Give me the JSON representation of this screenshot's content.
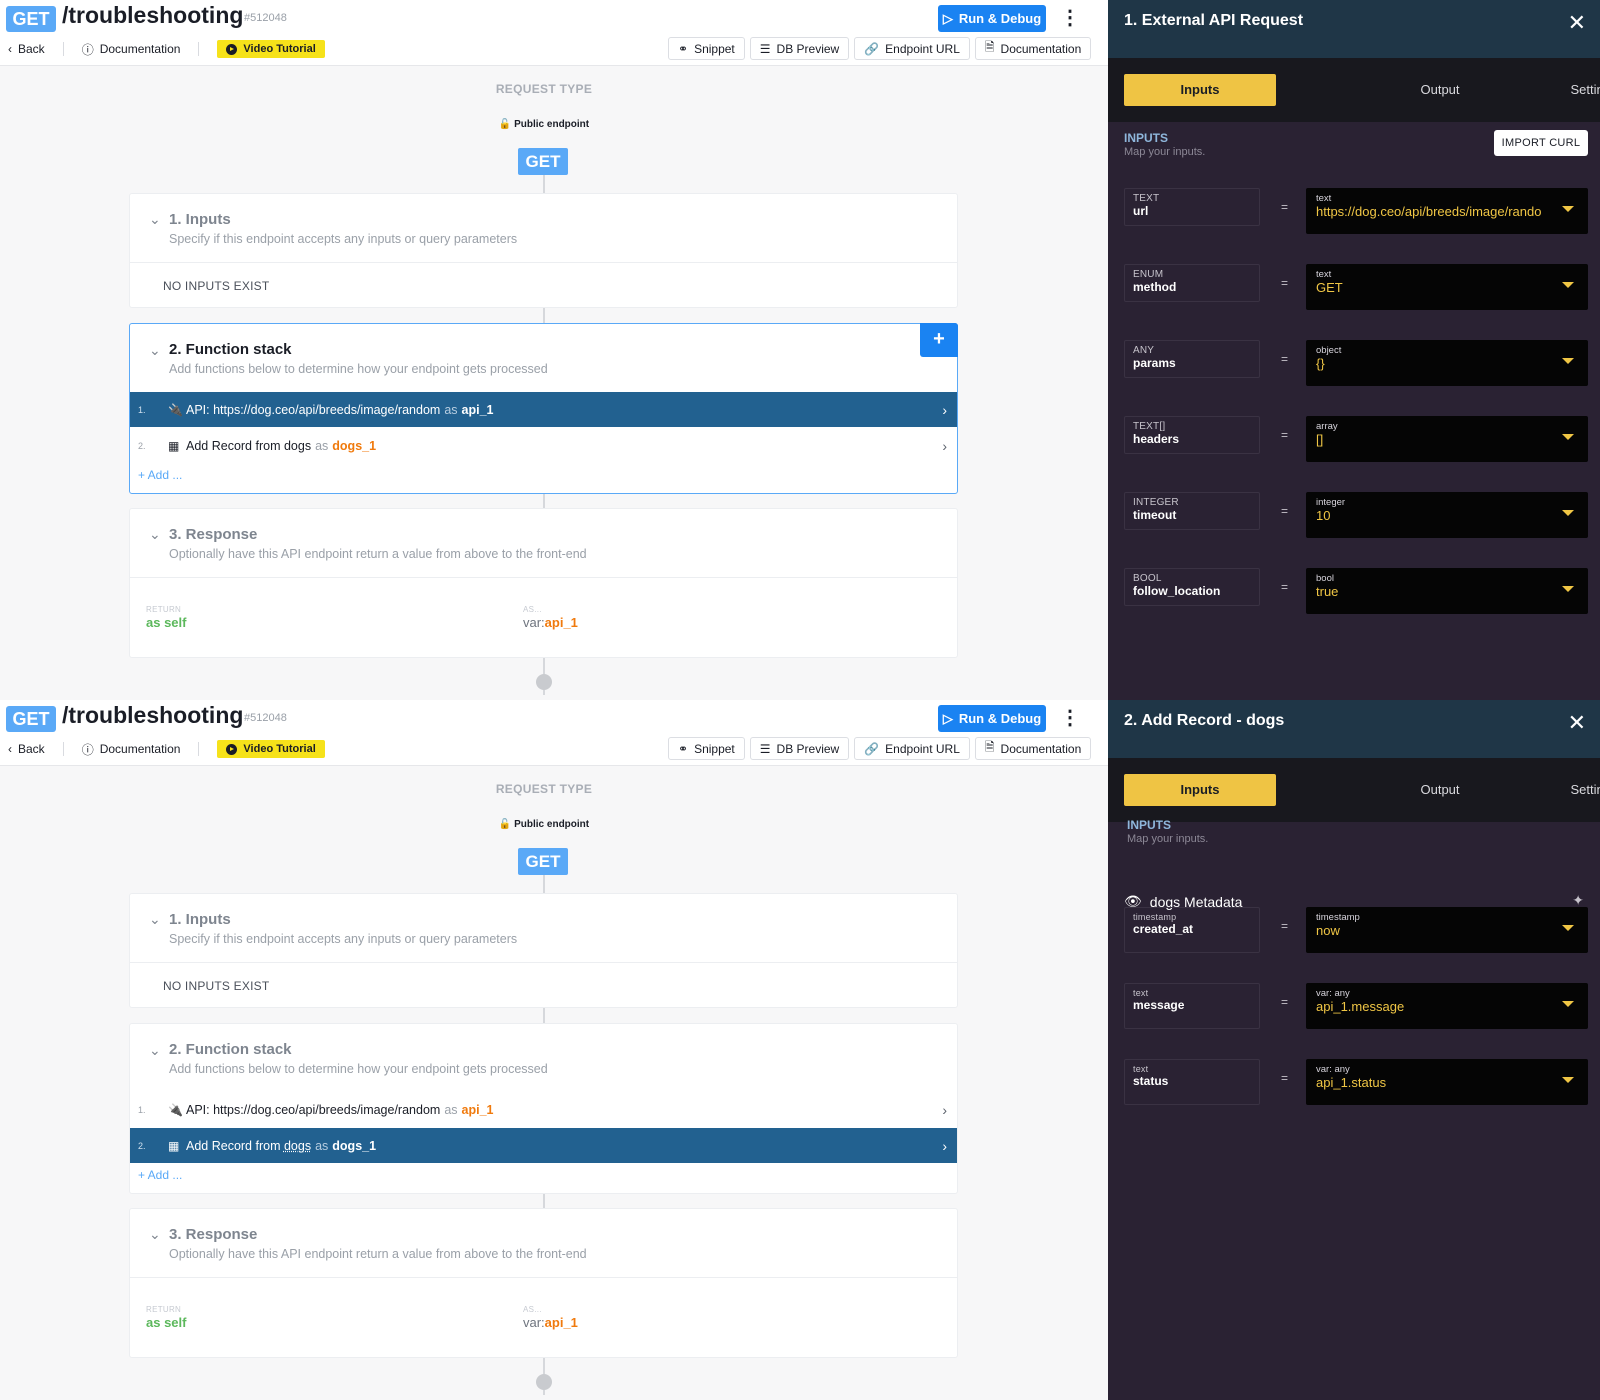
{
  "header": {
    "verb": "GET",
    "path": "/troubleshooting",
    "id": "#512048",
    "run_label": "Run & Debug",
    "back_label": "Back",
    "docs_label": "Documentation",
    "video_label": "Video Tutorial",
    "tools": [
      "Snippet",
      "DB Preview",
      "Endpoint URL",
      "Documentation"
    ]
  },
  "canvas": {
    "request_type": "REQUEST TYPE",
    "public_endpoint": "Public endpoint",
    "verb_pill": "GET",
    "inputs_title": "1. Inputs",
    "inputs_sub": "Specify if this endpoint accepts any inputs or query parameters",
    "no_inputs": "NO INPUTS EXIST",
    "stack_title": "2. Function stack",
    "stack_sub": "Add functions below to determine how your endpoint gets processed",
    "functions": [
      {
        "num": "1.",
        "label": "API: https://dog.ceo/api/breeds/image/random",
        "as": "as",
        "alias": "api_1"
      },
      {
        "num": "2.",
        "label_prefix": "Add Record from ",
        "table": "dogs",
        "as": "as",
        "alias": "dogs_1"
      }
    ],
    "add_label": "+ Add ...",
    "response_title": "3. Response",
    "response_sub": "Optionally have this API endpoint return a value from above to the front-end",
    "return_label": "RETURN",
    "return_value": "as self",
    "as_label": "AS...",
    "as_prefix": "var:",
    "as_value": "api_1"
  },
  "panel_api": {
    "title": "1. External API Request",
    "tabs": [
      "Inputs",
      "Output",
      "Settings"
    ],
    "inputs_head": "INPUTS",
    "inputs_sub": "Map your inputs.",
    "import_label": "IMPORT CURL",
    "rows": [
      {
        "ktype": "TEXT",
        "kname": "url",
        "vtype": "text",
        "value": "https://dog.ceo/api/breeds/image/rando"
      },
      {
        "ktype": "ENUM",
        "kname": "method",
        "vtype": "text",
        "value": "GET"
      },
      {
        "ktype": "ANY",
        "kname": "params",
        "vtype": "object",
        "value": "{}"
      },
      {
        "ktype": "TEXT[]",
        "kname": "headers",
        "vtype": "array",
        "value": "[]"
      },
      {
        "ktype": "INTEGER",
        "kname": "timeout",
        "vtype": "integer",
        "value": "10"
      },
      {
        "ktype": "BOOL",
        "kname": "follow_location",
        "vtype": "bool",
        "value": "true"
      }
    ]
  },
  "panel_record": {
    "title": "2. Add Record - dogs",
    "tabs": [
      "Inputs",
      "Output",
      "Settings"
    ],
    "inputs_head": "INPUTS",
    "inputs_sub": "Map your inputs.",
    "meta_label": "dogs Metadata",
    "rows": [
      {
        "ktype": "timestamp",
        "kname": "created_at",
        "vtype": "timestamp",
        "value": "now"
      },
      {
        "ktype": "text",
        "kname": "message",
        "vtype": "var: any",
        "value": "api_1.message"
      },
      {
        "ktype": "text",
        "kname": "status",
        "vtype": "var: any",
        "value": "api_1.status"
      }
    ]
  },
  "colors": {
    "accent": "#1a83f2",
    "verb": "#5aa9f7",
    "selected_row": "#226190",
    "alias": "#f07a0d",
    "panel_bg": "#2a2233",
    "tab_active": "#efc444"
  }
}
